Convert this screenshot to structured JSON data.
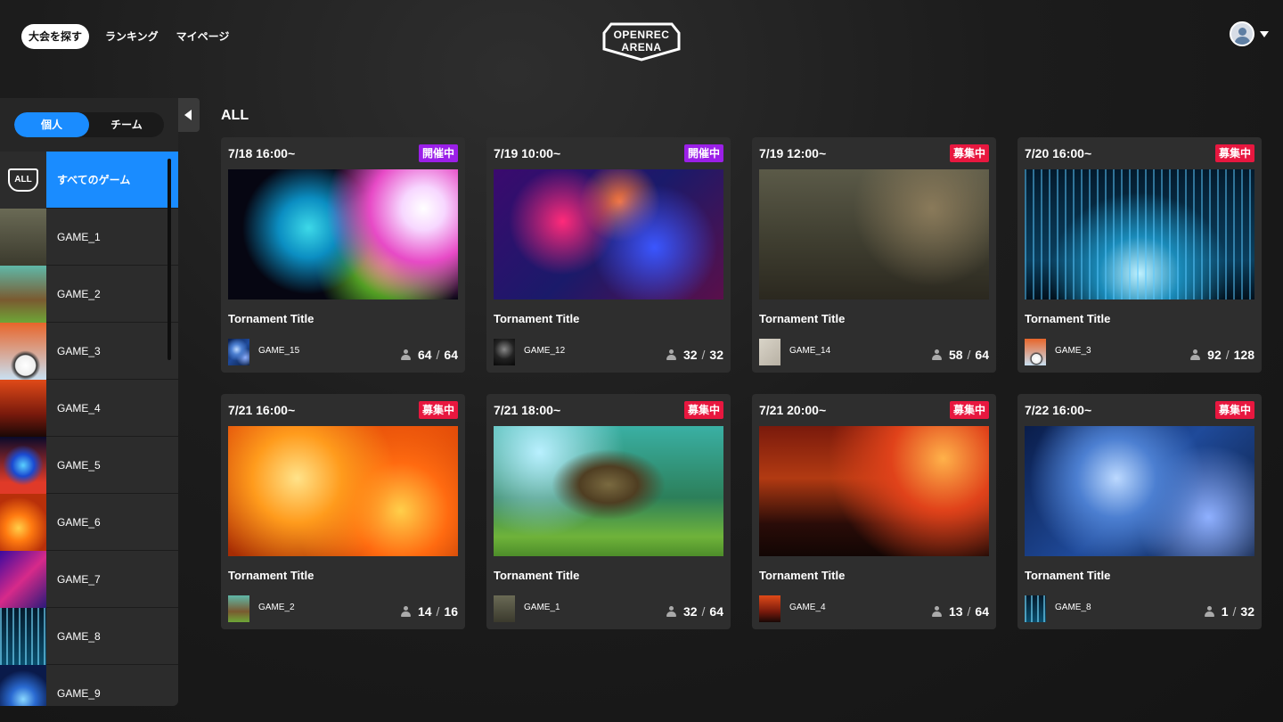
{
  "header": {
    "nav": [
      {
        "label": "大会を探す",
        "active": true
      },
      {
        "label": "ランキング",
        "active": false
      },
      {
        "label": "マイページ",
        "active": false
      }
    ],
    "logo_line1": "OPENREC",
    "logo_line2": "ARENA"
  },
  "sidebar": {
    "toggle": [
      {
        "label": "個人",
        "active": true
      },
      {
        "label": "チーム",
        "active": false
      }
    ],
    "all_badge": "ALL",
    "items": [
      {
        "label": "すべてのゲーム",
        "active": true,
        "thumb": "all-icon"
      },
      {
        "label": "GAME_1",
        "thumb": "img-tank"
      },
      {
        "label": "GAME_2",
        "thumb": "img-tree"
      },
      {
        "label": "GAME_3",
        "thumb": "img-ball"
      },
      {
        "label": "GAME_4",
        "thumb": "img-crowd"
      },
      {
        "label": "GAME_5",
        "thumb": "img-blue-flame"
      },
      {
        "label": "GAME_6",
        "thumb": "img-fire2"
      },
      {
        "label": "GAME_7",
        "thumb": "img-nebula2"
      },
      {
        "label": "GAME_8",
        "thumb": "img-rain2"
      },
      {
        "label": "GAME_9",
        "thumb": "img-portal"
      }
    ]
  },
  "main": {
    "section_title": "ALL",
    "cards": [
      {
        "date": "7/18 16:00~",
        "status": "開催中",
        "status_type": "live",
        "image": "img-colorburst",
        "title": "Tornament Title",
        "game": "GAME_15",
        "game_thumb": "img-space",
        "current": "64",
        "max": "64"
      },
      {
        "date": "7/19 10:00~",
        "status": "開催中",
        "status_type": "live",
        "image": "img-nebula",
        "title": "Tornament Title",
        "game": "GAME_12",
        "game_thumb": "img-dark-scratch",
        "current": "32",
        "max": "32"
      },
      {
        "date": "7/19 12:00~",
        "status": "募集中",
        "status_type": "recruit",
        "image": "img-war",
        "title": "Tornament Title",
        "game": "GAME_14",
        "game_thumb": "img-white",
        "current": "58",
        "max": "64"
      },
      {
        "date": "7/20 16:00~",
        "status": "募集中",
        "status_type": "recruit",
        "image": "img-rain",
        "title": "Tornament Title",
        "game": "GAME_3",
        "game_thumb": "img-ball",
        "current": "92",
        "max": "128"
      },
      {
        "date": "7/21 16:00~",
        "status": "募集中",
        "status_type": "recruit",
        "image": "img-fire",
        "title": "Tornament Title",
        "game": "GAME_2",
        "game_thumb": "img-tree",
        "current": "14",
        "max": "16"
      },
      {
        "date": "7/21 18:00~",
        "status": "募集中",
        "status_type": "recruit",
        "image": "img-forest",
        "title": "Tornament Title",
        "game": "GAME_1",
        "game_thumb": "img-tank",
        "current": "32",
        "max": "64"
      },
      {
        "date": "7/21 20:00~",
        "status": "募集中",
        "status_type": "recruit",
        "image": "img-zombie",
        "title": "Tornament Title",
        "game": "GAME_4",
        "game_thumb": "img-crowd",
        "current": "13",
        "max": "64"
      },
      {
        "date": "7/22 16:00~",
        "status": "募集中",
        "status_type": "recruit",
        "image": "img-space",
        "title": "Tornament Title",
        "game": "GAME_8",
        "game_thumb": "img-rain2",
        "current": "1",
        "max": "32"
      }
    ],
    "slash": "/"
  },
  "colors": {
    "accent": "#1a8cff",
    "live": "#9b1fe8",
    "recruit": "#e8173f"
  }
}
